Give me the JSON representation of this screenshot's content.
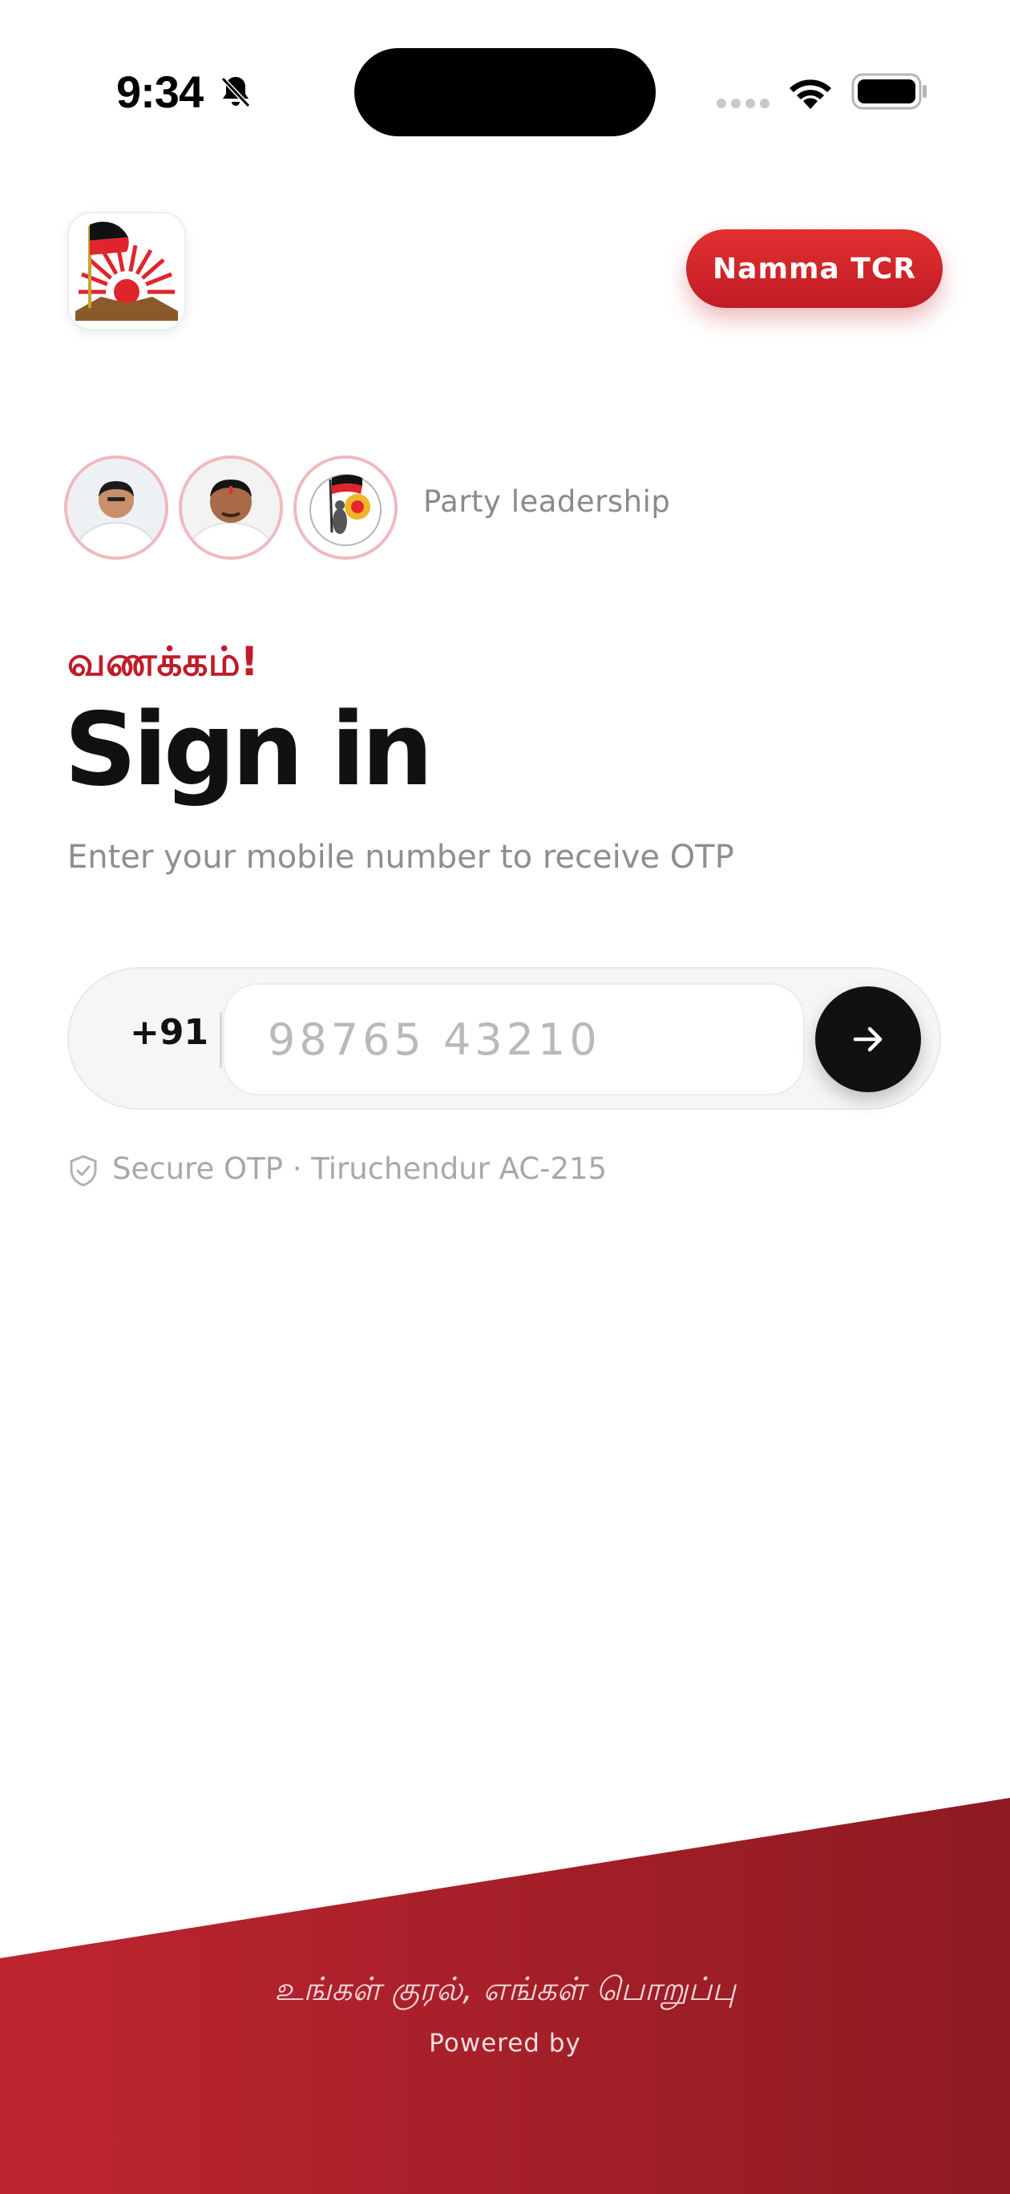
{
  "status_bar": {
    "time": "9:34",
    "icons": [
      "bell-slash-icon",
      "cellular-signal-icon",
      "wifi-icon",
      "battery-icon"
    ]
  },
  "header": {
    "logo_icon": "party-logo-rising-sun-icon",
    "brand_label": "Namma TCR"
  },
  "leadership": {
    "label": "Party leadership",
    "avatars": [
      "leader-avatar-1",
      "leader-avatar-2",
      "party-emblem-avatar"
    ]
  },
  "signin": {
    "greeting": "வணக்கம்!",
    "title": "Sign in",
    "subtitle": "Enter your mobile number to receive OTP",
    "country_code": "+91",
    "phone_value": "",
    "phone_placeholder": "98765 43210",
    "submit_icon": "arrow-right-icon",
    "secure_note": "Secure OTP · Tiruchendur AC-215"
  },
  "footer": {
    "tagline": "உங்கள் குரல், எங்கள் பொறுப்பு",
    "powered_by": "Powered by"
  },
  "colors": {
    "accent_red": "#c01c2a",
    "brand_gradient_start": "#e2302f",
    "brand_gradient_end": "#c01c25",
    "footer_red": "#b0202c",
    "button_black": "#111111"
  }
}
